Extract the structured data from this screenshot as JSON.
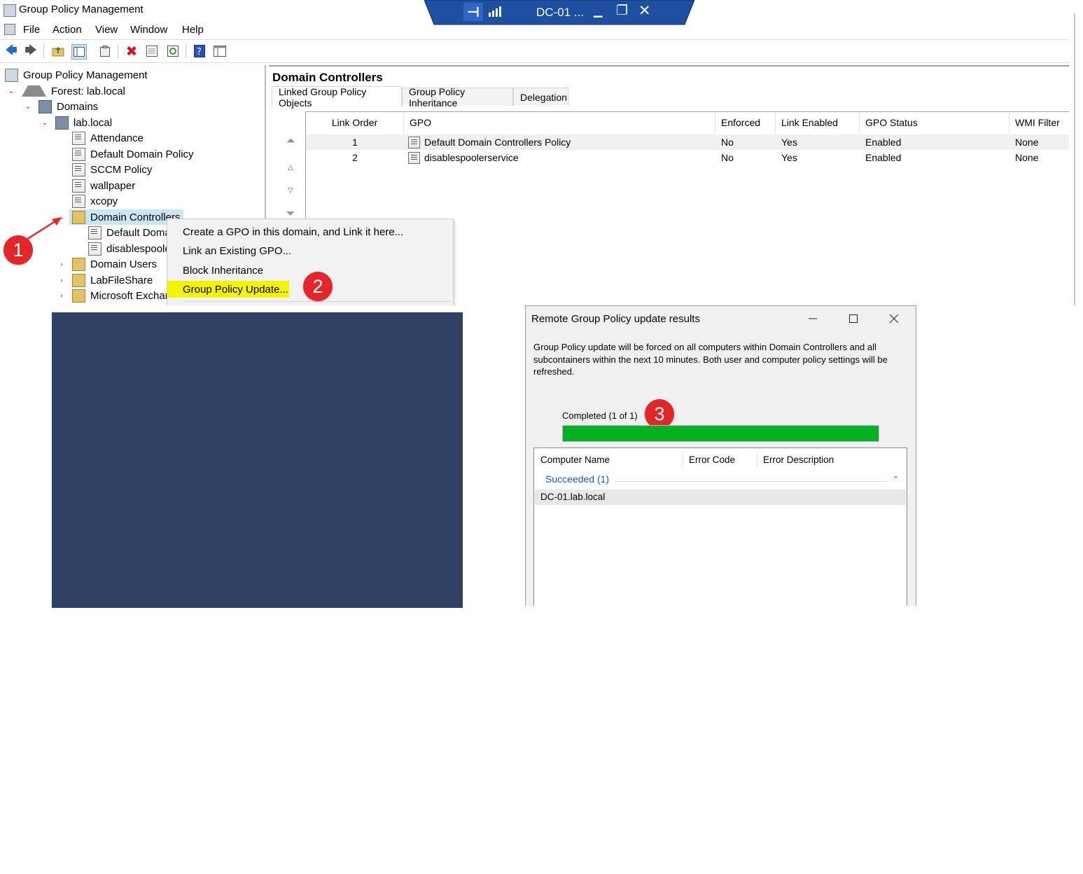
{
  "window": {
    "title": "Group Policy Management"
  },
  "menu": [
    "File",
    "Action",
    "View",
    "Window",
    "Help"
  ],
  "toolbar_icons": [
    "back-arrow-icon",
    "forward-arrow-icon",
    "up-folder-icon",
    "show-hide-tree-icon",
    "properties-icon",
    "delete-icon",
    "export-list-icon",
    "refresh-icon",
    "help-icon",
    "console-icon"
  ],
  "rdp_bar": {
    "label": "DC-01 ...",
    "pin_glyph": "⊣",
    "minimize_glyph": "▁",
    "restore_glyph": "❐",
    "close_glyph": "✕"
  },
  "tree": {
    "root": "Group Policy Management",
    "forest": "Forest: lab.local",
    "domains": "Domains",
    "domain": "lab.local",
    "gpos": [
      "Attendance",
      "Default Domain Policy",
      "SCCM Policy",
      "wallpaper",
      "xcopy"
    ],
    "selected_ou": "Domain Controllers",
    "ou_children": [
      "Default Doma",
      "disablespoole"
    ],
    "other_ous": [
      "Domain Users",
      "LabFileShare",
      "Microsoft Exchan"
    ]
  },
  "right_pane": {
    "title": "Domain Controllers",
    "tabs": [
      "Linked Group Policy Objects",
      "Group Policy Inheritance",
      "Delegation"
    ],
    "columns": [
      "Link Order",
      "GPO",
      "Enforced",
      "Link Enabled",
      "GPO Status",
      "WMI Filter"
    ],
    "rows": [
      {
        "order": "1",
        "gpo": "Default Domain Controllers Policy",
        "enforced": "No",
        "link_enabled": "Yes",
        "status": "Enabled",
        "wmi": "None"
      },
      {
        "order": "2",
        "gpo": "disablespoolerservice",
        "enforced": "No",
        "link_enabled": "Yes",
        "status": "Enabled",
        "wmi": "None"
      }
    ]
  },
  "context_menu": {
    "items": [
      "Create a GPO in this domain, and Link it here...",
      "Link an Existing GPO...",
      "Block Inheritance",
      "Group Policy Update..."
    ],
    "highlighted": "Group Policy Update..."
  },
  "annotations": {
    "badge1": "1",
    "badge2": "2",
    "badge3": "3",
    "arrow_color": "#e3262a",
    "highlight_color": "#f5f500"
  },
  "dialog": {
    "title": "Remote Group Policy update results",
    "message": "Group Policy update will be forced on all computers within Domain Controllers and all subcontainers within the next 10 minutes. Both user and computer policy settings will be refreshed.",
    "status": "Completed (1 of 1)",
    "progress_fraction": 1.0,
    "progress_color": "#06b025",
    "columns": [
      "Computer Name",
      "Error Code",
      "Error Description"
    ],
    "group_label": "Succeeded (1)",
    "results": [
      "DC-01.lab.local"
    ]
  },
  "colors": {
    "navy_block": "#2e4064",
    "selection": "#cce4f7",
    "rdp_bar": "#1e4fa0"
  }
}
